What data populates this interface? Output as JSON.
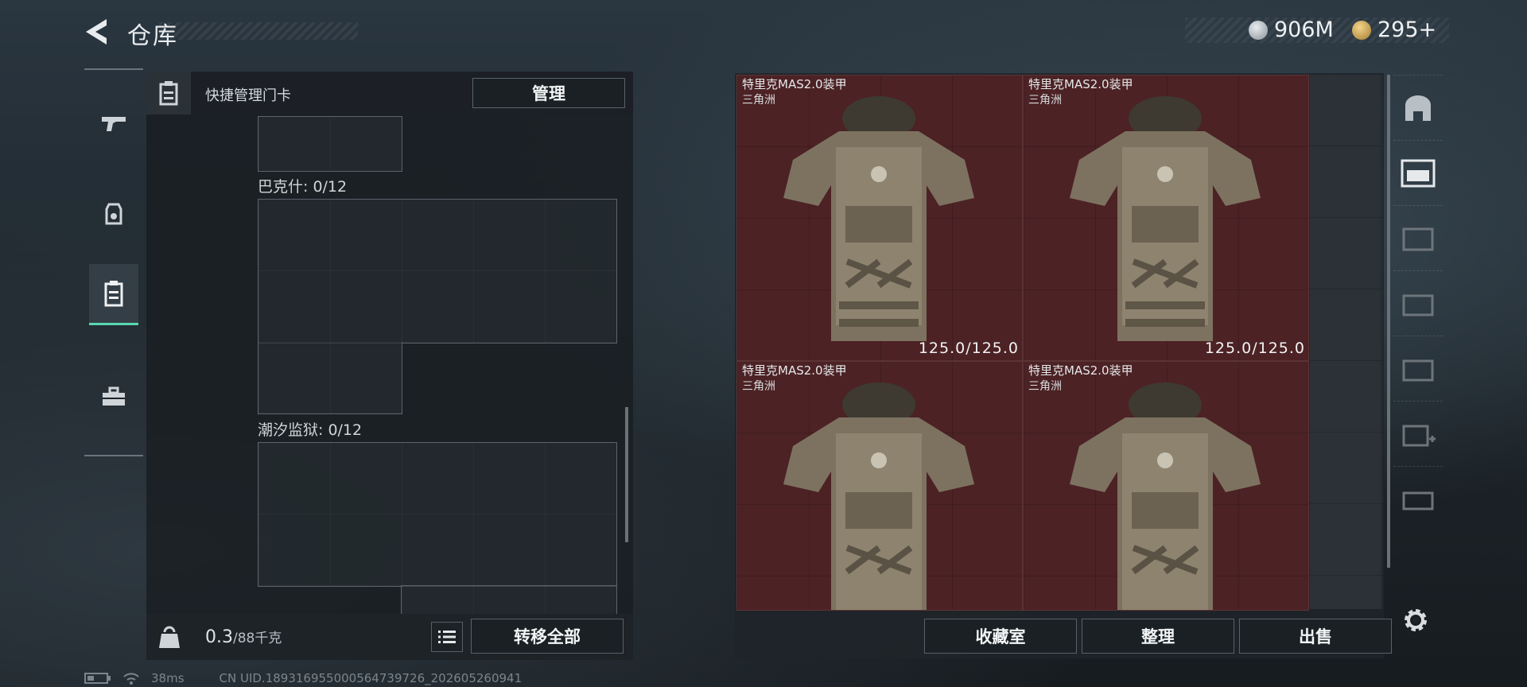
{
  "header": {
    "title": "仓库",
    "currency_1": "906M",
    "currency_2": "295+"
  },
  "nav": {
    "items": [
      "pistol-icon",
      "loot-icon",
      "card-holder-icon",
      "toolbox-icon"
    ]
  },
  "left_panel": {
    "header_label": "快捷管理门卡",
    "manage_button": "管理",
    "sections": [
      {
        "label": "巴克什: 0/12"
      },
      {
        "label": "潮汐监狱: 0/12"
      }
    ],
    "weight_current": "0.3",
    "weight_suffix": "/88千克",
    "transfer_all_button": "转移全部"
  },
  "items": [
    {
      "name": "特里克MAS2.0装甲",
      "origin": "三角洲",
      "durability": "125.0/125.0"
    },
    {
      "name": "特里克MAS2.0装甲",
      "origin": "三角洲",
      "durability": "125.0/125.0"
    },
    {
      "name": "特里克MAS2.0装甲",
      "origin": "三角洲",
      "durability": ""
    },
    {
      "name": "特里克MAS2.0装甲",
      "origin": "三角洲",
      "durability": ""
    }
  ],
  "right_panel": {
    "collection_button": "收藏室",
    "sort_button": "整理",
    "sell_button": "出售"
  },
  "side_strip": [
    "vault-icon",
    "gti-case-icon",
    "iv-case-icon",
    "gti-case-2-icon",
    "iv-case-2-icon",
    "iv-case-add-icon",
    "gti-case-3-icon"
  ],
  "status": {
    "ping": "38ms",
    "uid": "CN UID.18931695500056473972­6_202605260941"
  },
  "colors": {
    "accent": "#58d6b0",
    "card_bg": "#4c2225"
  }
}
